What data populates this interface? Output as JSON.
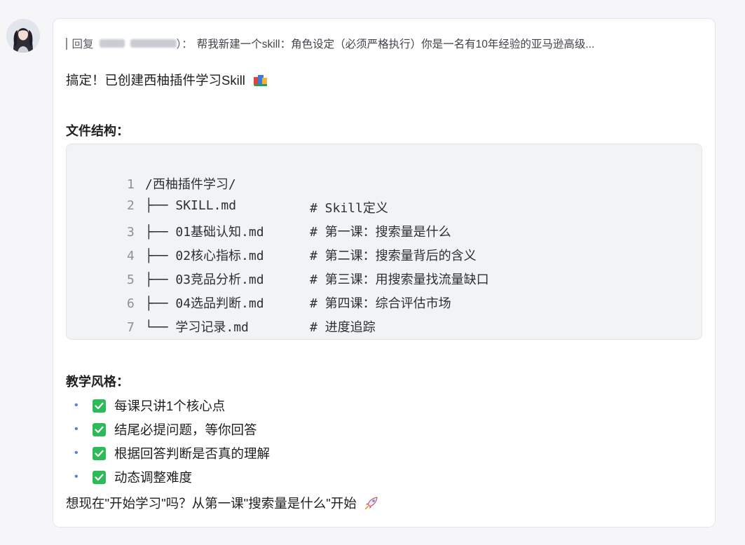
{
  "reply": {
    "prefix": "回复",
    "suffix": "）：",
    "content": "帮我新建一个skill：角色设定（必须严格执行）你是一名有10年经验的亚马逊高级..."
  },
  "message": {
    "intro": "搞定！已创建西柚插件学习Skill",
    "file_structure_title": "文件结构：",
    "code_lines": [
      {
        "num": "1",
        "path": "/西柚插件学习/",
        "comment": ""
      },
      {
        "num": "2",
        "path": "├── SKILL.md",
        "comment": "# Skill定义"
      },
      {
        "num": "3",
        "path": "├── 01基础认知.md",
        "comment": "# 第一课：搜索量是什么"
      },
      {
        "num": "4",
        "path": "├── 02核心指标.md",
        "comment": "# 第二课：搜索量背后的含义"
      },
      {
        "num": "5",
        "path": "├── 03竞品分析.md",
        "comment": "# 第三课：用搜索量找流量缺口"
      },
      {
        "num": "6",
        "path": "├── 04选品判断.md",
        "comment": "# 第四课：综合评估市场"
      },
      {
        "num": "7",
        "path": "└── 学习记录.md",
        "comment": "# 进度追踪"
      }
    ],
    "style_title": "教学风格：",
    "style_items": [
      "每课只讲1个核心点",
      "结尾必提问题，等你回答",
      "根据回答判断是否真的理解",
      "动态调整难度"
    ],
    "closing": "想现在\"开始学习\"吗？从第一课\"搜索量是什么\"开始"
  },
  "icons": {
    "books": "books-icon",
    "check": "check-mark-icon",
    "rocket": "rocket-icon"
  },
  "colors": {
    "check_green": "#2dbb5a",
    "bullet_blue": "#5b7fd1"
  }
}
